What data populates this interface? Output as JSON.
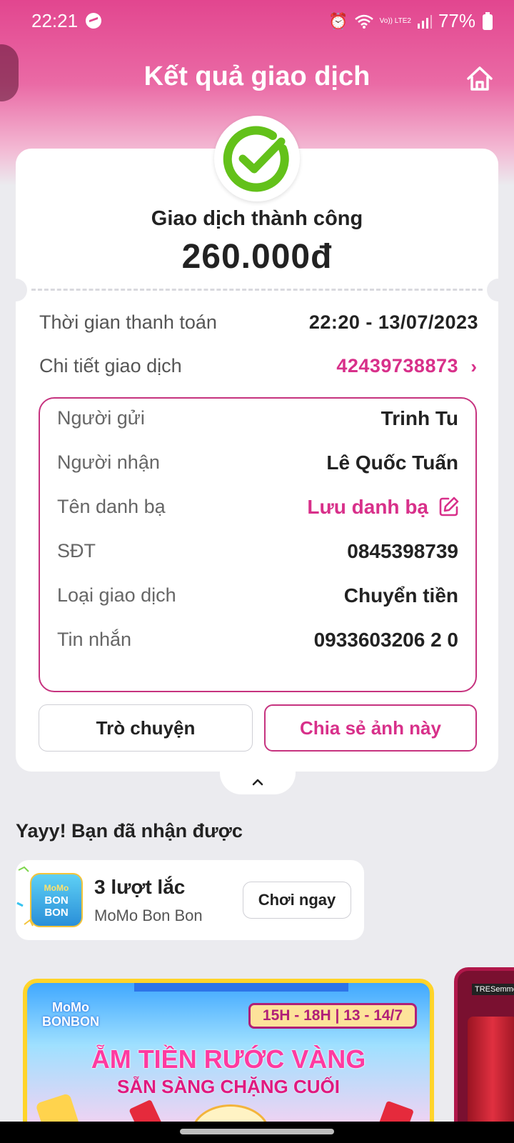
{
  "status_bar": {
    "time": "22:21",
    "network": "Vo)) LTE2",
    "battery": "77%"
  },
  "header": {
    "title": "Kết quả giao dịch"
  },
  "transaction": {
    "status": "Giao dịch thành công",
    "amount": "260.000đ",
    "pay_time_label": "Thời gian thanh toán",
    "pay_time_value": "22:20 - 13/07/2023",
    "detail_label": "Chi tiết giao dịch",
    "detail_value": "42439738873"
  },
  "details": [
    {
      "label": "Người gửi",
      "value": "Trinh Tu"
    },
    {
      "label": "Người nhận",
      "value": "Lê Quốc Tuấn"
    },
    {
      "label": "Tên danh bạ",
      "value": "Lưu danh bạ"
    },
    {
      "label": "SĐT",
      "value": "0845398739"
    },
    {
      "label": "Loại giao dịch",
      "value": "Chuyển tiền"
    },
    {
      "label": "Tin nhắn",
      "value": "0933603206 2 0"
    }
  ],
  "actions": {
    "chat_label": "Trò chuyện",
    "share_label": "Chia sẻ ảnh này"
  },
  "reward": {
    "title": "Yayy! Bạn đã nhận được",
    "main": "3 lượt lắc",
    "sub": "MoMo Bon Bon",
    "button": "Chơi ngay",
    "logo_text_1": "MoMo",
    "logo_text_2": "BON",
    "logo_text_3": "BON"
  },
  "banner": {
    "logo": "MoMo BONBON",
    "date": "15H - 18H | 13 - 14/7",
    "line1": "ẴM TIỀN RƯỚC VÀNG",
    "line2": "SẴN SÀNG CHẶNG CUỐI"
  },
  "banner2": {
    "brand": "TRESemmé"
  },
  "colors": {
    "brand_pink": "#d8308a",
    "success_green": "#63c11a",
    "header_gradient_top": "#e2468f"
  },
  "icons": {
    "home": "home-icon",
    "check": "check-circle-icon",
    "edit": "edit-icon",
    "chevron_right": "chevron-right-icon",
    "chevron_up": "chevron-up-icon"
  }
}
